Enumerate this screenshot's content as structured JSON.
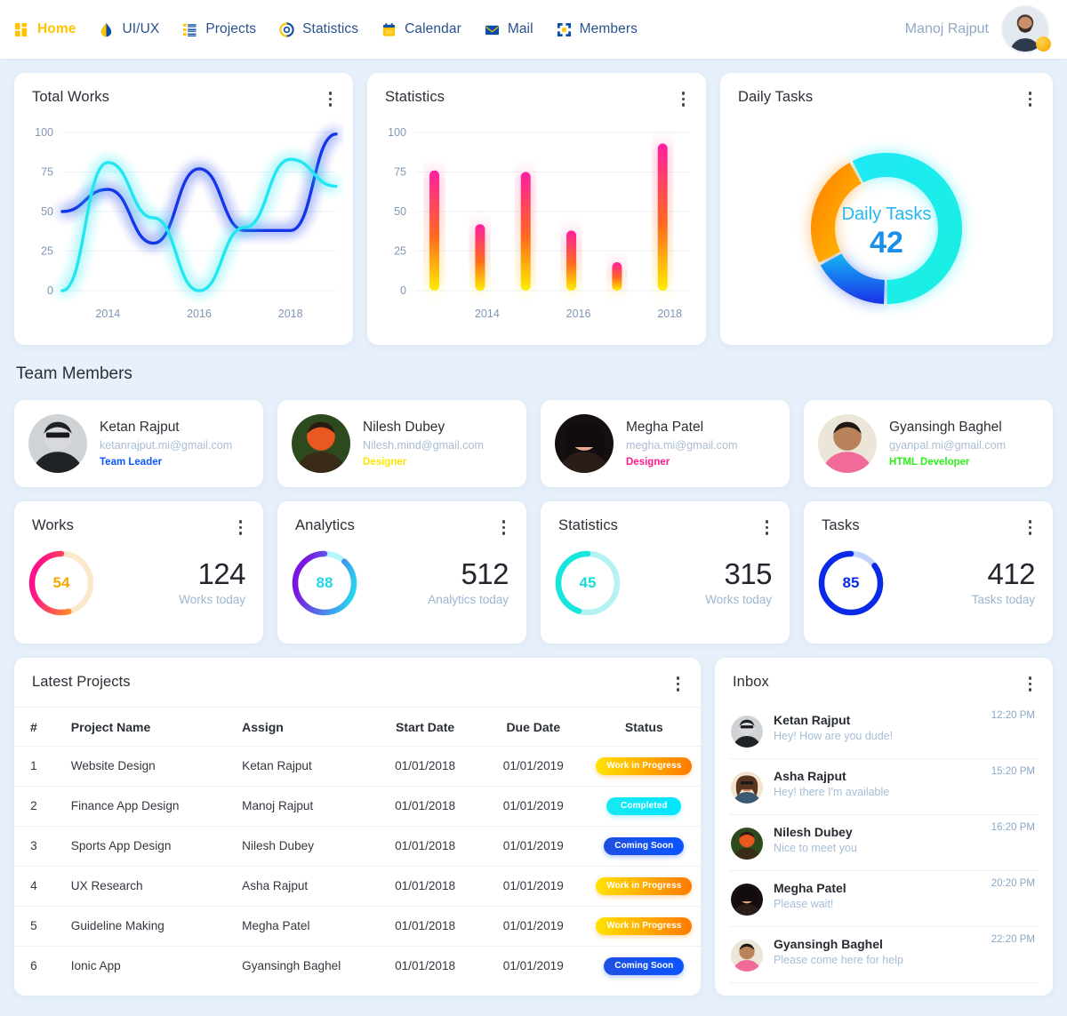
{
  "nav": {
    "items": [
      {
        "label": "Home",
        "icon": "grid-icon",
        "active": true
      },
      {
        "label": "UI/UX",
        "icon": "droplet-icon",
        "active": false
      },
      {
        "label": "Projects",
        "icon": "list-icon",
        "active": false
      },
      {
        "label": "Statistics",
        "icon": "gauge-icon",
        "active": false
      },
      {
        "label": "Calendar",
        "icon": "calendar-icon",
        "active": false
      },
      {
        "label": "Mail",
        "icon": "envelope-icon",
        "active": false
      },
      {
        "label": "Members",
        "icon": "frame-corners-icon",
        "active": false
      }
    ],
    "user_name": "Manoj Rajput"
  },
  "cards": {
    "total_works_title": "Total Works",
    "statistics_title": "Statistics",
    "daily_tasks_title": "Daily Tasks"
  },
  "chart_data": [
    {
      "type": "line",
      "title": "Total Works",
      "x": [
        2013,
        2014,
        2015,
        2016,
        2017,
        2018,
        2019
      ],
      "xtick_labels": [
        "2014",
        "2016",
        "2018"
      ],
      "ylim": [
        0,
        100
      ],
      "ytick_labels": [
        "0",
        "25",
        "50",
        "75",
        "100"
      ],
      "grid": true,
      "series": [
        {
          "name": "series-blue",
          "color": "#1236e8",
          "values": [
            50,
            64,
            30,
            77,
            38,
            38,
            99
          ]
        },
        {
          "name": "series-cyan",
          "color": "#23e6f0",
          "values": [
            0,
            81,
            46,
            0,
            40,
            83,
            66
          ]
        }
      ]
    },
    {
      "type": "bar",
      "title": "Statistics",
      "categories": [
        "2013",
        "2014",
        "2015",
        "2016",
        "2017",
        "2018"
      ],
      "xtick_labels": [
        "2014",
        "2016",
        "2018"
      ],
      "values": [
        76,
        42,
        75,
        38,
        18,
        93
      ],
      "ylim": [
        0,
        100
      ],
      "ytick_labels": [
        "0",
        "25",
        "50",
        "75",
        "100"
      ],
      "grid": true,
      "bar_gradient": [
        "#ffee00",
        "#ff1ea0"
      ]
    },
    {
      "type": "pie",
      "title": "Daily Tasks",
      "center_label": "Daily Tasks",
      "center_value": "42",
      "labels": [
        "cyan-segment",
        "blue-segment",
        "orange-segment"
      ],
      "values": [
        58,
        17,
        25
      ],
      "colors": [
        "#1ee9f5",
        "#1b4fe8",
        "#ff8a00"
      ]
    }
  ],
  "team": {
    "section_title": "Team Members",
    "members": [
      {
        "name": "Ketan Rajput",
        "email": "ketanrajput.mi@gmail.com",
        "role": "Team Leader",
        "role_color": "#0a58ff"
      },
      {
        "name": "Nilesh Dubey",
        "email": "Nilesh.mind@gmail.com",
        "role": "Designer",
        "role_color": "#ffe600"
      },
      {
        "name": "Megha Patel",
        "email": "megha.mi@gmail.com",
        "role": "Designer",
        "role_color": "#ff1a8c"
      },
      {
        "name": "Gyansingh Baghel",
        "email": "gyanpal.mi@gmail.com",
        "role": "HTML Developer",
        "role_color": "#2bf01a"
      }
    ]
  },
  "stats": [
    {
      "title": "Works",
      "gauge_value": "54",
      "percent": 54,
      "number": "124",
      "sub": "Works today",
      "track": "#fbe9cd",
      "from": "#ffc400",
      "to": "#ff1189",
      "num_color": "#f5a900"
    },
    {
      "title": "Analytics",
      "gauge_value": "88",
      "percent": 88,
      "number": "512",
      "sub": "Analytics today",
      "track": "#b7f5f8",
      "from": "#1fe8f2",
      "to": "#7c15e0",
      "num_color": "#1fd8e8"
    },
    {
      "title": "Statistics",
      "gauge_value": "45",
      "percent": 45,
      "number": "315",
      "sub": "Works today",
      "track": "#b4f3f2",
      "from": "#16e6db",
      "to": "#16e6db",
      "num_color": "#16ded6"
    },
    {
      "title": "Tasks",
      "gauge_value": "85",
      "percent": 85,
      "number": "412",
      "sub": "Tasks today",
      "track": "#c2d4fb",
      "from": "#0a2ae8",
      "to": "#0a2ae8",
      "num_color": "#0a2ae8"
    }
  ],
  "projects": {
    "title": "Latest Projects",
    "columns": [
      "#",
      "Project Name",
      "Assign",
      "Start Date",
      "Due Date",
      "Status"
    ],
    "rows": [
      {
        "num": "1",
        "name": "Website Design",
        "assign": "Ketan Rajput",
        "start": "01/01/2018",
        "due": "01/01/2019",
        "status": "Work in Progress",
        "status_type": "wip"
      },
      {
        "num": "2",
        "name": "Finance App Design",
        "assign": "Manoj Rajput",
        "start": "01/01/2018",
        "due": "01/01/2019",
        "status": "Completed",
        "status_type": "done"
      },
      {
        "num": "3",
        "name": "Sports App Design",
        "assign": "Nilesh Dubey",
        "start": "01/01/2018",
        "due": "01/01/2019",
        "status": "Coming Soon",
        "status_type": "soon"
      },
      {
        "num": "4",
        "name": "UX Research",
        "assign": "Asha Rajput",
        "start": "01/01/2018",
        "due": "01/01/2019",
        "status": "Work in Progress",
        "status_type": "wip"
      },
      {
        "num": "5",
        "name": "Guideline Making",
        "assign": "Megha Patel",
        "start": "01/01/2018",
        "due": "01/01/2019",
        "status": "Work in Progress",
        "status_type": "wip"
      },
      {
        "num": "6",
        "name": "Ionic App",
        "assign": "Gyansingh Baghel",
        "start": "01/01/2018",
        "due": "01/01/2019",
        "status": "Coming Soon",
        "status_type": "soon"
      }
    ]
  },
  "inbox": {
    "title": "Inbox",
    "messages": [
      {
        "name": "Ketan Rajput",
        "message": "Hey! How are you dude!",
        "time": "12:20 PM"
      },
      {
        "name": "Asha Rajput",
        "message": "Hey! there I'm available",
        "time": "15:20 PM"
      },
      {
        "name": "Nilesh Dubey",
        "message": "Nice to meet you",
        "time": "16:20 PM"
      },
      {
        "name": "Megha Patel",
        "message": "Please wait!",
        "time": "20:20 PM"
      },
      {
        "name": "Gyansingh Baghel",
        "message": "Please come here for help",
        "time": "22:20 PM"
      }
    ]
  }
}
